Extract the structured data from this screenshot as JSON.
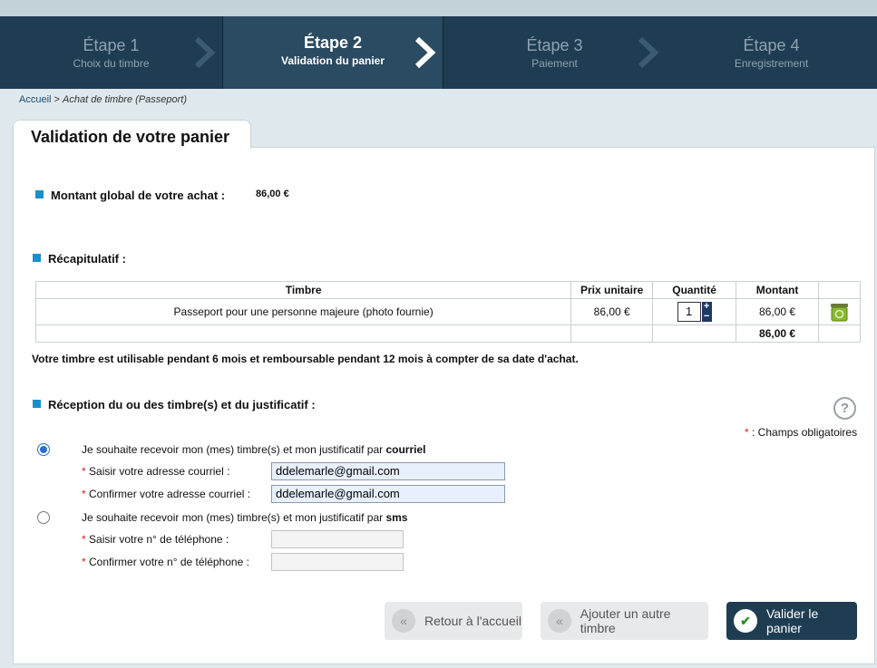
{
  "steps": [
    {
      "title": "Étape 1",
      "subtitle": "Choix du timbre"
    },
    {
      "title": "Étape 2",
      "subtitle": "Validation du panier"
    },
    {
      "title": "Étape 3",
      "subtitle": "Paiement"
    },
    {
      "title": "Étape 4",
      "subtitle": "Enregistrement"
    }
  ],
  "breadcrumb": {
    "home": "Accueil",
    "separator": ">",
    "current": "Achat de timbre (Passeport)"
  },
  "page_title": "Validation de votre panier",
  "total_section": {
    "label": "Montant global de votre achat :",
    "value": "86,00 €"
  },
  "recap": {
    "label": "Récapitulatif :",
    "headers": [
      "Timbre",
      "Prix unitaire",
      "Quantité",
      "Montant"
    ],
    "row": {
      "stamp": "Passeport pour une personne majeure (photo fournie)",
      "unit_price": "86,00 €",
      "quantity": "1",
      "amount": "86,00 €"
    },
    "total": "86,00 €"
  },
  "validity_note": "Votre timbre est utilisable pendant 6 mois et remboursable pendant 12 mois à compter de sa date d'achat.",
  "reception": {
    "label": "Réception du ou des timbre(s) et du justificatif :",
    "help": "?",
    "required_star": "*",
    "required_note": ": Champs obligatoires",
    "email_option": {
      "text": "Je souhaite recevoir mon (mes) timbre(s) et mon justificatif par",
      "channel": "courriel",
      "selected": true
    },
    "email_label": "Saisir votre adresse courriel :",
    "email_value": "ddelemarle@gmail.com",
    "email_confirm_label": "Confirmer votre adresse courriel :",
    "email_confirm_value": "ddelemarle@gmail.com",
    "sms_option": {
      "text": "Je souhaite recevoir mon (mes) timbre(s) et mon justificatif par",
      "channel": "sms",
      "selected": false
    },
    "phone_label": "Saisir votre n° de téléphone :",
    "phone_value": "",
    "phone_confirm_label": "Confirmer votre n° de téléphone :",
    "phone_confirm_value": ""
  },
  "buttons": {
    "home": "Retour à l'accueil",
    "add": "Ajouter un autre timbre",
    "validate": "Valider le panier"
  },
  "icons": {
    "back": "double-chevron-left-icon",
    "validate": "check-icon",
    "delete": "trash-icon"
  },
  "colors": {
    "header": "#1f3d52",
    "active_step": "#2a4b61",
    "accent": "#1a8fc9",
    "required": "#d81e1e"
  }
}
